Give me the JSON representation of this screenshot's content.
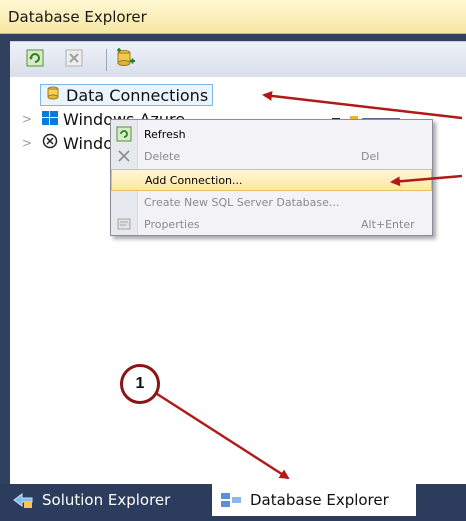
{
  "window": {
    "title": "Database Explorer"
  },
  "toolbar": {
    "buttons": [
      {
        "name": "refresh",
        "icon": "refresh-icon"
      },
      {
        "name": "delete",
        "icon": "delete-icon"
      },
      {
        "name": "connect-to-database",
        "icon": "connect-database-icon"
      }
    ]
  },
  "tree": {
    "items": [
      {
        "label": "Data Connections",
        "icon": "data-connections-icon",
        "selected": true
      },
      {
        "label": "Windows Azure",
        "icon": "windows-azure-icon"
      },
      {
        "label": "Windows",
        "icon": "windows-icon"
      }
    ]
  },
  "context_menu": {
    "items": [
      {
        "label": "Refresh",
        "shortcut": "",
        "icon": "refresh-icon",
        "enabled": true
      },
      {
        "label": "Delete",
        "shortcut": "Del",
        "icon": "delete-icon",
        "enabled": false
      },
      {
        "label": "Add Connection...",
        "shortcut": "",
        "icon": "",
        "enabled": true,
        "highlighted": true
      },
      {
        "label": "Create New SQL Server Database...",
        "shortcut": "",
        "icon": "",
        "enabled": false
      },
      {
        "label": "Properties",
        "shortcut": "Alt+Enter",
        "icon": "properties-icon",
        "enabled": false
      }
    ]
  },
  "bottom_tabs": [
    {
      "label": "Solution Explorer",
      "icon": "solution-explorer-icon",
      "active": false
    },
    {
      "label": "Database Explorer",
      "icon": "database-explorer-icon",
      "active": true
    }
  ],
  "annotation": {
    "step_number": "1",
    "arrow_color": "#b21a1a"
  },
  "colors": {
    "titlebar": "#f7e7a4",
    "frame": "#30415f",
    "menu_highlight": "#ffe79f"
  }
}
